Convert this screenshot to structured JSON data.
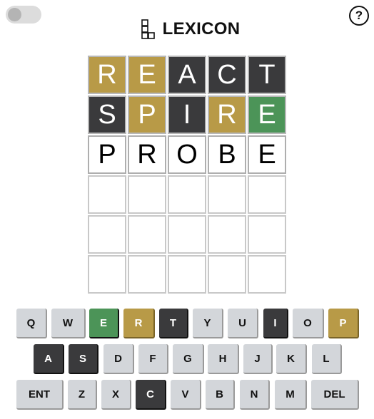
{
  "header": {
    "title": "LEXICON",
    "help_label": "?"
  },
  "toggle": {
    "on": false
  },
  "colors": {
    "correct": "#4c9458",
    "present": "#b89a47",
    "absent": "#3a3a3c",
    "key_default": "#d3d6da"
  },
  "board": {
    "rows": [
      [
        {
          "letter": "R",
          "state": "present"
        },
        {
          "letter": "E",
          "state": "present"
        },
        {
          "letter": "A",
          "state": "absent"
        },
        {
          "letter": "C",
          "state": "absent"
        },
        {
          "letter": "T",
          "state": "absent"
        }
      ],
      [
        {
          "letter": "S",
          "state": "absent"
        },
        {
          "letter": "P",
          "state": "present"
        },
        {
          "letter": "I",
          "state": "absent"
        },
        {
          "letter": "R",
          "state": "present"
        },
        {
          "letter": "E",
          "state": "correct"
        }
      ],
      [
        {
          "letter": "P",
          "state": "filled"
        },
        {
          "letter": "R",
          "state": "filled"
        },
        {
          "letter": "O",
          "state": "filled"
        },
        {
          "letter": "B",
          "state": "filled"
        },
        {
          "letter": "E",
          "state": "filled"
        }
      ],
      [
        {
          "letter": "",
          "state": "empty"
        },
        {
          "letter": "",
          "state": "empty"
        },
        {
          "letter": "",
          "state": "empty"
        },
        {
          "letter": "",
          "state": "empty"
        },
        {
          "letter": "",
          "state": "empty"
        }
      ],
      [
        {
          "letter": "",
          "state": "empty"
        },
        {
          "letter": "",
          "state": "empty"
        },
        {
          "letter": "",
          "state": "empty"
        },
        {
          "letter": "",
          "state": "empty"
        },
        {
          "letter": "",
          "state": "empty"
        }
      ],
      [
        {
          "letter": "",
          "state": "empty"
        },
        {
          "letter": "",
          "state": "empty"
        },
        {
          "letter": "",
          "state": "empty"
        },
        {
          "letter": "",
          "state": "empty"
        },
        {
          "letter": "",
          "state": "empty"
        }
      ]
    ]
  },
  "keyboard": {
    "rows": [
      [
        {
          "label": "Q",
          "state": "default"
        },
        {
          "label": "W",
          "state": "default"
        },
        {
          "label": "E",
          "state": "correct"
        },
        {
          "label": "R",
          "state": "present"
        },
        {
          "label": "T",
          "state": "absent"
        },
        {
          "label": "Y",
          "state": "default"
        },
        {
          "label": "U",
          "state": "default"
        },
        {
          "label": "I",
          "state": "absent"
        },
        {
          "label": "O",
          "state": "default"
        },
        {
          "label": "P",
          "state": "present"
        }
      ],
      [
        {
          "label": "A",
          "state": "absent"
        },
        {
          "label": "S",
          "state": "absent"
        },
        {
          "label": "D",
          "state": "default"
        },
        {
          "label": "F",
          "state": "default"
        },
        {
          "label": "G",
          "state": "default"
        },
        {
          "label": "H",
          "state": "default"
        },
        {
          "label": "J",
          "state": "default"
        },
        {
          "label": "K",
          "state": "default"
        },
        {
          "label": "L",
          "state": "default"
        }
      ],
      [
        {
          "label": "ENT",
          "state": "default"
        },
        {
          "label": "Z",
          "state": "default"
        },
        {
          "label": "X",
          "state": "default"
        },
        {
          "label": "C",
          "state": "absent"
        },
        {
          "label": "V",
          "state": "default"
        },
        {
          "label": "B",
          "state": "default"
        },
        {
          "label": "N",
          "state": "default"
        },
        {
          "label": "M",
          "state": "default"
        },
        {
          "label": "DEL",
          "state": "default"
        }
      ]
    ]
  }
}
